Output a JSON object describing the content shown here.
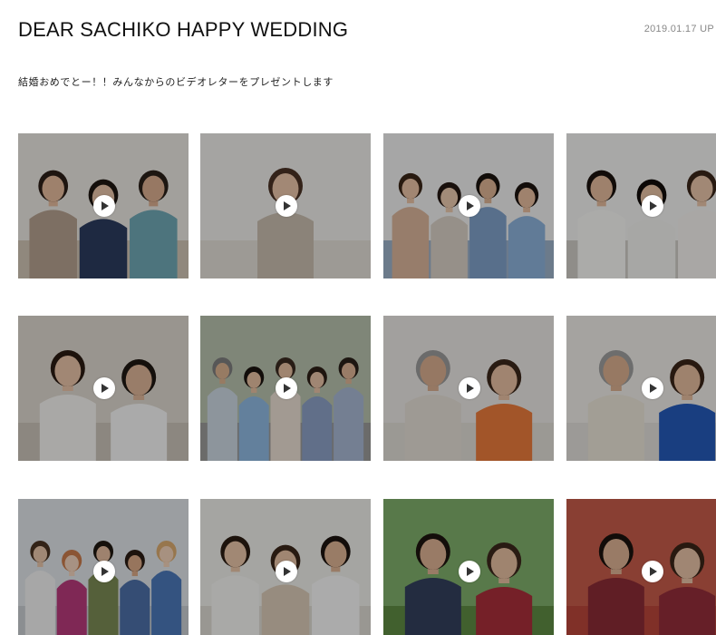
{
  "header": {
    "title": "DEAR SACHIKO HAPPY WEDDING",
    "upload_date": "2019.01.17 UP"
  },
  "message": "結婚おめでとー！！みんなからのビデオレターをプレゼントします",
  "videos": [
    {
      "thumb": {
        "bg": "#e9e5e0",
        "floor": "#cfc3b3",
        "people": [
          {
            "skin": "#e2b99b",
            "hair": "#2b1f18",
            "shirt": "#b4a08e"
          },
          {
            "skin": "#e6c2a6",
            "hair": "#1e1611",
            "shirt": "#2c3b5e"
          },
          {
            "skin": "#d9ad8f",
            "hair": "#2a2019",
            "shirt": "#6fa6b4"
          }
        ]
      }
    },
    {
      "thumb": {
        "bg": "#ecebe8",
        "floor": "#e1ddd6",
        "people": [
          {
            "skin": "#e8c3a8",
            "hair": "#4a3124",
            "shirt": "#c8bcae"
          }
        ]
      }
    },
    {
      "thumb": {
        "bg": "#eeeeee",
        "floor": "#9bb0c8",
        "people": [
          {
            "skin": "#e7c0a4",
            "hair": "#3a2618",
            "shirt": "#d9b49a"
          },
          {
            "skin": "#e9c8ad",
            "hair": "#241812",
            "shirt": "#d7cfc4"
          },
          {
            "skin": "#dcb293",
            "hair": "#1b130e",
            "shirt": "#7f9fc7"
          },
          {
            "skin": "#e4bb9d",
            "hair": "#1c140f",
            "shirt": "#8cb0d8"
          }
        ]
      }
    },
    {
      "thumb": {
        "bg": "#f1f1ef",
        "floor": "#cdcac4",
        "people": [
          {
            "skin": "#e2b99b",
            "hair": "#1a120d",
            "shirt": "#f5f5f3"
          },
          {
            "skin": "#e6c0a3",
            "hair": "#120c09",
            "shirt": "#f0efed"
          },
          {
            "skin": "#e7c3a8",
            "hair": "#3a2619",
            "shirt": "#f2f0ec"
          }
        ]
      }
    },
    {
      "thumb": {
        "bg": "#dcd6cd",
        "floor": "#c9c2b8",
        "people": [
          {
            "skin": "#e7c2a6",
            "hair": "#2a1b12",
            "shirt": "#f3f1ee"
          },
          {
            "skin": "#dcb497",
            "hair": "#1f1712",
            "shirt": "#f4f4f4"
          }
        ]
      }
    },
    {
      "thumb": {
        "bg": "#b7c0ad",
        "floor": "#9a9a98",
        "people": [
          {
            "skin": "#d9b08f",
            "hair": "#7d7d7d",
            "shirt": "#cbd6e0"
          },
          {
            "skin": "#e4bda0",
            "hair": "#1b140f",
            "shirt": "#8fb8e0"
          },
          {
            "skin": "#e4bda0",
            "hair": "#3a2a20",
            "shirt": "#e8ddd2"
          },
          {
            "skin": "#e6c1a5",
            "hair": "#2d1f16",
            "shirt": "#8b9fc4"
          },
          {
            "skin": "#dcb294",
            "hair": "#2a2019",
            "shirt": "#a7b7d1"
          }
        ]
      }
    },
    {
      "thumb": {
        "bg": "#e9e6e2",
        "floor": "#dfdbd5",
        "people": [
          {
            "skin": "#d7ad8e",
            "hair": "#9a9a9a",
            "shirt": "#e3ddd4"
          },
          {
            "skin": "#e5bea1",
            "hair": "#3c271b",
            "shirt": "#e87a3c"
          }
        ]
      }
    },
    {
      "thumb": {
        "bg": "#eceae6",
        "floor": "#e0ddd8",
        "people": [
          {
            "skin": "#d9ae8e",
            "hair": "#9c9c9c",
            "shirt": "#e9e2d6"
          },
          {
            "skin": "#e3ba9c",
            "hair": "#3a2418",
            "shirt": "#2459b8"
          }
        ]
      }
    },
    {
      "thumb": {
        "bg": "#dfe3e7",
        "floor": "#c8ccd0",
        "people": [
          {
            "skin": "#e6c3a8",
            "hair": "#4a3322",
            "shirt": "#f0f0f0"
          },
          {
            "skin": "#efd2bc",
            "hair": "#c87a4b",
            "shirt": "#b63a7a"
          },
          {
            "skin": "#e2bb9e",
            "hair": "#1f1711",
            "shirt": "#7a8a54"
          },
          {
            "skin": "#d9a886",
            "hair": "#2a1c14",
            "shirt": "#4c6fa6"
          },
          {
            "skin": "#efd0b8",
            "hair": "#d9a96f",
            "shirt": "#4b78b8"
          }
        ]
      }
    },
    {
      "thumb": {
        "bg": "#ecece8",
        "floor": "#dcd9d2",
        "people": [
          {
            "skin": "#e7c3a7",
            "hair": "#2a1c12",
            "shirt": "#f2f2f0"
          },
          {
            "skin": "#e6c0a4",
            "hair": "#3a2619",
            "shirt": "#d8c9b6"
          },
          {
            "skin": "#dcb293",
            "hair": "#1c140f",
            "shirt": "#f5f5f5"
          }
        ]
      }
    },
    {
      "thumb": {
        "bg": "#7fae6a",
        "floor": "#5d8a43",
        "people": [
          {
            "skin": "#dcb192",
            "hair": "#1d150f",
            "shirt": "#33405c"
          },
          {
            "skin": "#e4bd9f",
            "hair": "#3b281c",
            "shirt": "#a82e3a"
          }
        ]
      }
    },
    {
      "thumb": {
        "bg": "#c45b49",
        "floor": "#b8463a",
        "people": [
          {
            "skin": "#dcb192",
            "hair": "#1a120d",
            "shirt": "#8a2b36"
          },
          {
            "skin": "#e6c1a5",
            "hair": "#3a2418",
            "shirt": "#932d3a"
          }
        ]
      }
    }
  ]
}
